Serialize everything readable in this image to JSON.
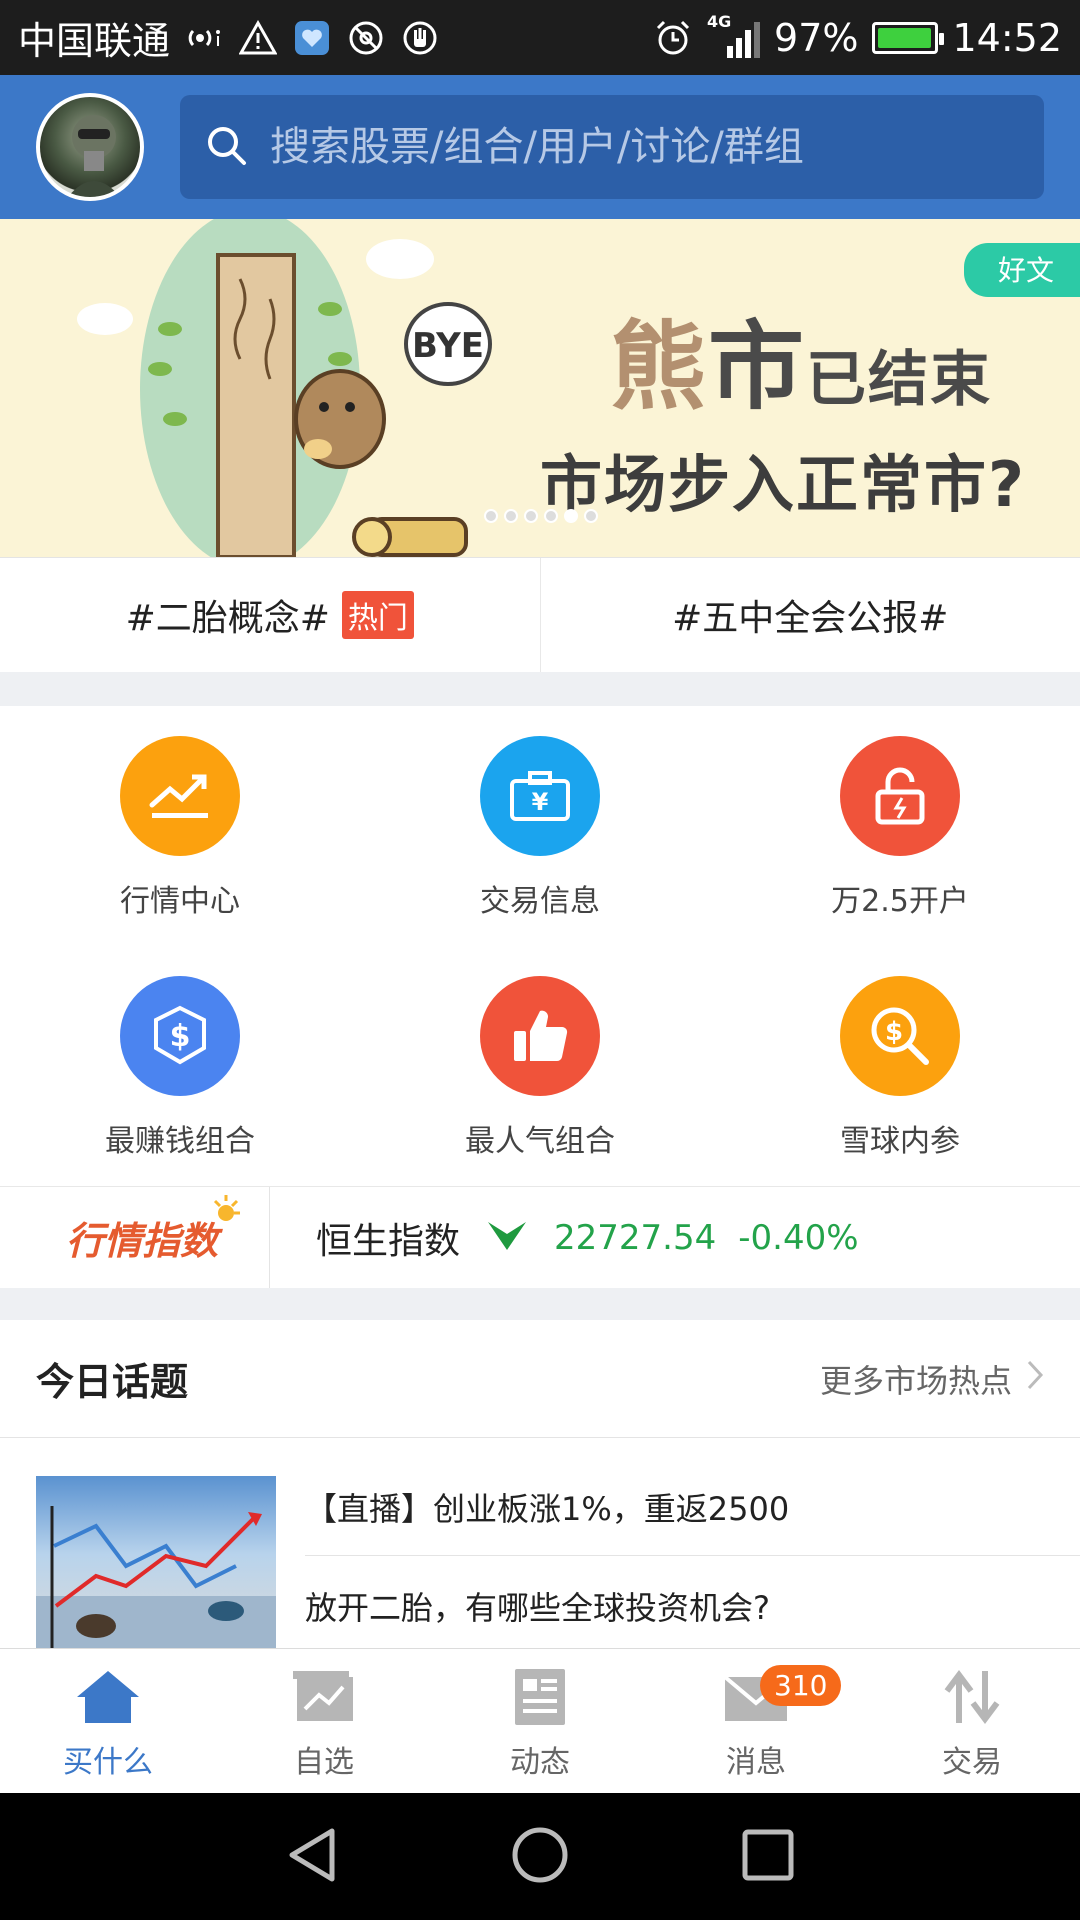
{
  "status_bar": {
    "carrier": "中国联通",
    "network": "4G",
    "battery": "97%",
    "battery_level": 0.97,
    "time": "14:52"
  },
  "header": {
    "search_placeholder": "搜索股票/组合/用户/讨论/群组"
  },
  "banner": {
    "tag": "好文",
    "headline_big": "熊",
    "headline_small": "市",
    "headline_sub": "已结束",
    "headline2": "市场步入正常市?",
    "bye_text": "BYE",
    "page_count": 6,
    "active_page": 5
  },
  "topics": [
    {
      "label": "#二胎概念#",
      "badge": "热门"
    },
    {
      "label": "#五中全会公报#"
    }
  ],
  "grid": [
    {
      "label": "行情中心",
      "icon": "trend-chart-icon",
      "color": "#fca10e"
    },
    {
      "label": "交易信息",
      "icon": "briefcase-yen-icon",
      "color": "#1ba4ee"
    },
    {
      "label": "万2.5开户",
      "icon": "unlock-icon",
      "color": "#f0533a"
    },
    {
      "label": "最赚钱组合",
      "icon": "dollar-hexagon-icon",
      "color": "#4b84f0"
    },
    {
      "label": "最人气组合",
      "icon": "thumbs-up-icon",
      "color": "#f0533a"
    },
    {
      "label": "雪球内参",
      "icon": "dollar-search-icon",
      "color": "#fca10e"
    }
  ],
  "index_bar": {
    "logo": "行情指数",
    "name": "恒生指数",
    "value": "22727.54",
    "change": "-0.40%",
    "color": "#23a34a"
  },
  "today": {
    "title": "今日话题",
    "more": "更多市场热点",
    "news": [
      "【直播】创业板涨1%，重返2500",
      "放开二胎，有哪些全球投资机会?"
    ]
  },
  "bottom_nav": [
    {
      "label": "买什么",
      "icon": "home-icon",
      "active": true
    },
    {
      "label": "自选",
      "icon": "stock-chart-icon"
    },
    {
      "label": "动态",
      "icon": "feed-icon"
    },
    {
      "label": "消息",
      "icon": "mail-icon",
      "badge": "310"
    },
    {
      "label": "交易",
      "icon": "transfer-arrows-icon"
    }
  ],
  "colors": {
    "brand": "#3c78c8",
    "down": "#23a34a",
    "hot": "#f0533a"
  }
}
